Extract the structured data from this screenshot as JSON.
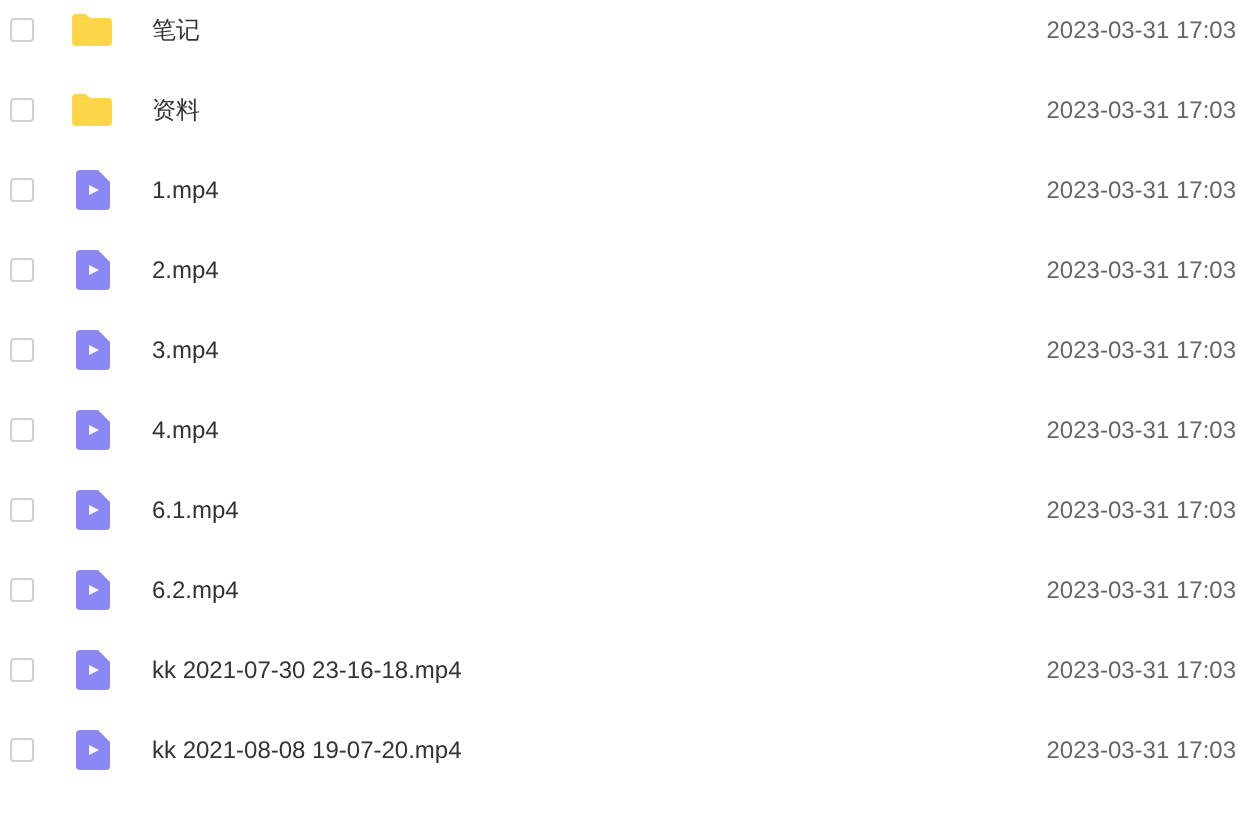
{
  "files": [
    {
      "kind": "folder",
      "name": "笔记",
      "modified": "2023-03-31 17:03",
      "checked": false
    },
    {
      "kind": "folder",
      "name": "资料",
      "modified": "2023-03-31 17:03",
      "checked": false
    },
    {
      "kind": "video",
      "name": "1.mp4",
      "modified": "2023-03-31 17:03",
      "checked": false
    },
    {
      "kind": "video",
      "name": "2.mp4",
      "modified": "2023-03-31 17:03",
      "checked": false
    },
    {
      "kind": "video",
      "name": "3.mp4",
      "modified": "2023-03-31 17:03",
      "checked": false
    },
    {
      "kind": "video",
      "name": "4.mp4",
      "modified": "2023-03-31 17:03",
      "checked": false
    },
    {
      "kind": "video",
      "name": "6.1.mp4",
      "modified": "2023-03-31 17:03",
      "checked": false
    },
    {
      "kind": "video",
      "name": "6.2.mp4",
      "modified": "2023-03-31 17:03",
      "checked": false
    },
    {
      "kind": "video",
      "name": "kk 2021-07-30 23-16-18.mp4",
      "modified": "2023-03-31 17:03",
      "checked": false
    },
    {
      "kind": "video",
      "name": "kk 2021-08-08 19-07-20.mp4",
      "modified": "2023-03-31 17:03",
      "checked": false
    }
  ]
}
